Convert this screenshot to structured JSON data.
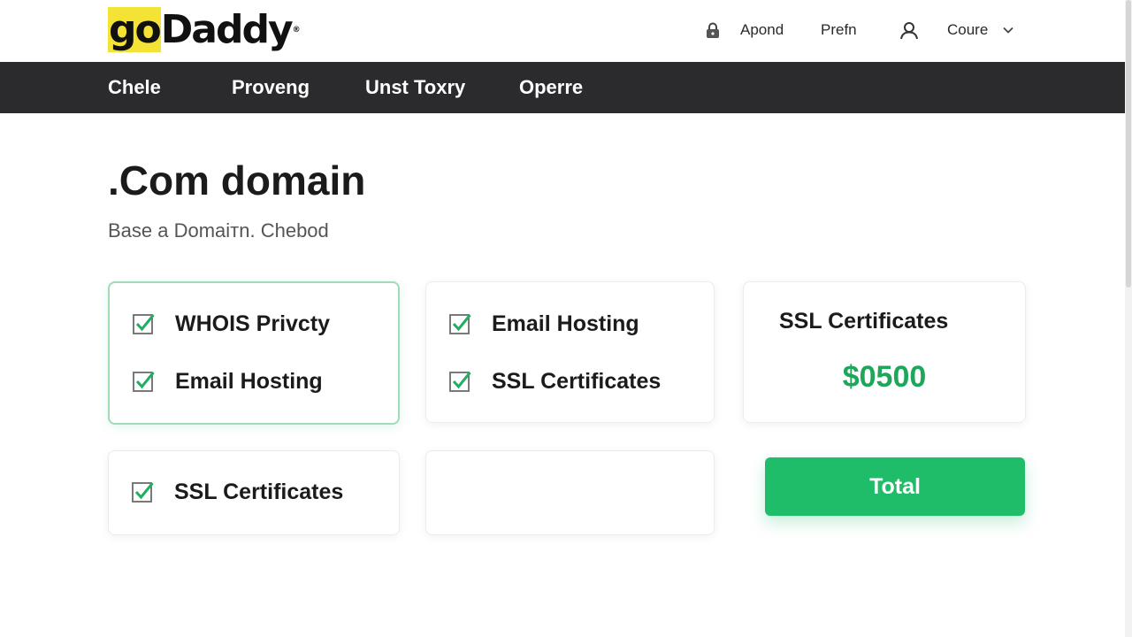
{
  "header": {
    "logo": {
      "part_highlight": "go",
      "part_rest": "Daddy",
      "mark": "®"
    },
    "items": [
      {
        "icon": "lock-icon",
        "label": "Apond"
      },
      {
        "label": "Prefn"
      },
      {
        "icon": "user-icon",
        "label": "Coure",
        "chevron": "chevron-down-icon"
      }
    ]
  },
  "nav": {
    "items": [
      {
        "label": "Chele"
      },
      {
        "label": "Proveng"
      },
      {
        "label": "Unst Toxry"
      },
      {
        "label": "Operre"
      }
    ]
  },
  "main": {
    "title": ".Com domain",
    "subtitle": "Base a Domaiтn. Chebod",
    "cards": [
      {
        "selected": true,
        "options": [
          {
            "label": "WHOIS Privcty",
            "checked": true
          },
          {
            "label": "Email Hosting",
            "checked": true
          }
        ]
      },
      {
        "selected": false,
        "options": [
          {
            "label": "Email Hosting",
            "checked": true
          },
          {
            "label": "SSL Certificates",
            "checked": true
          }
        ]
      },
      {
        "title": "SSL Certificates",
        "price": "$0500"
      },
      {
        "selected": false,
        "options": [
          {
            "label": "SSL Certificates",
            "checked": true
          }
        ]
      },
      {
        "selected": false,
        "options": []
      }
    ],
    "total_button": "Total"
  },
  "colors": {
    "accent_green": "#1fbd6a",
    "price_green": "#1ea65a",
    "nav_bg": "#2b2b2e",
    "logo_highlight": "#f4e235",
    "selected_border": "#9fdcb7"
  }
}
